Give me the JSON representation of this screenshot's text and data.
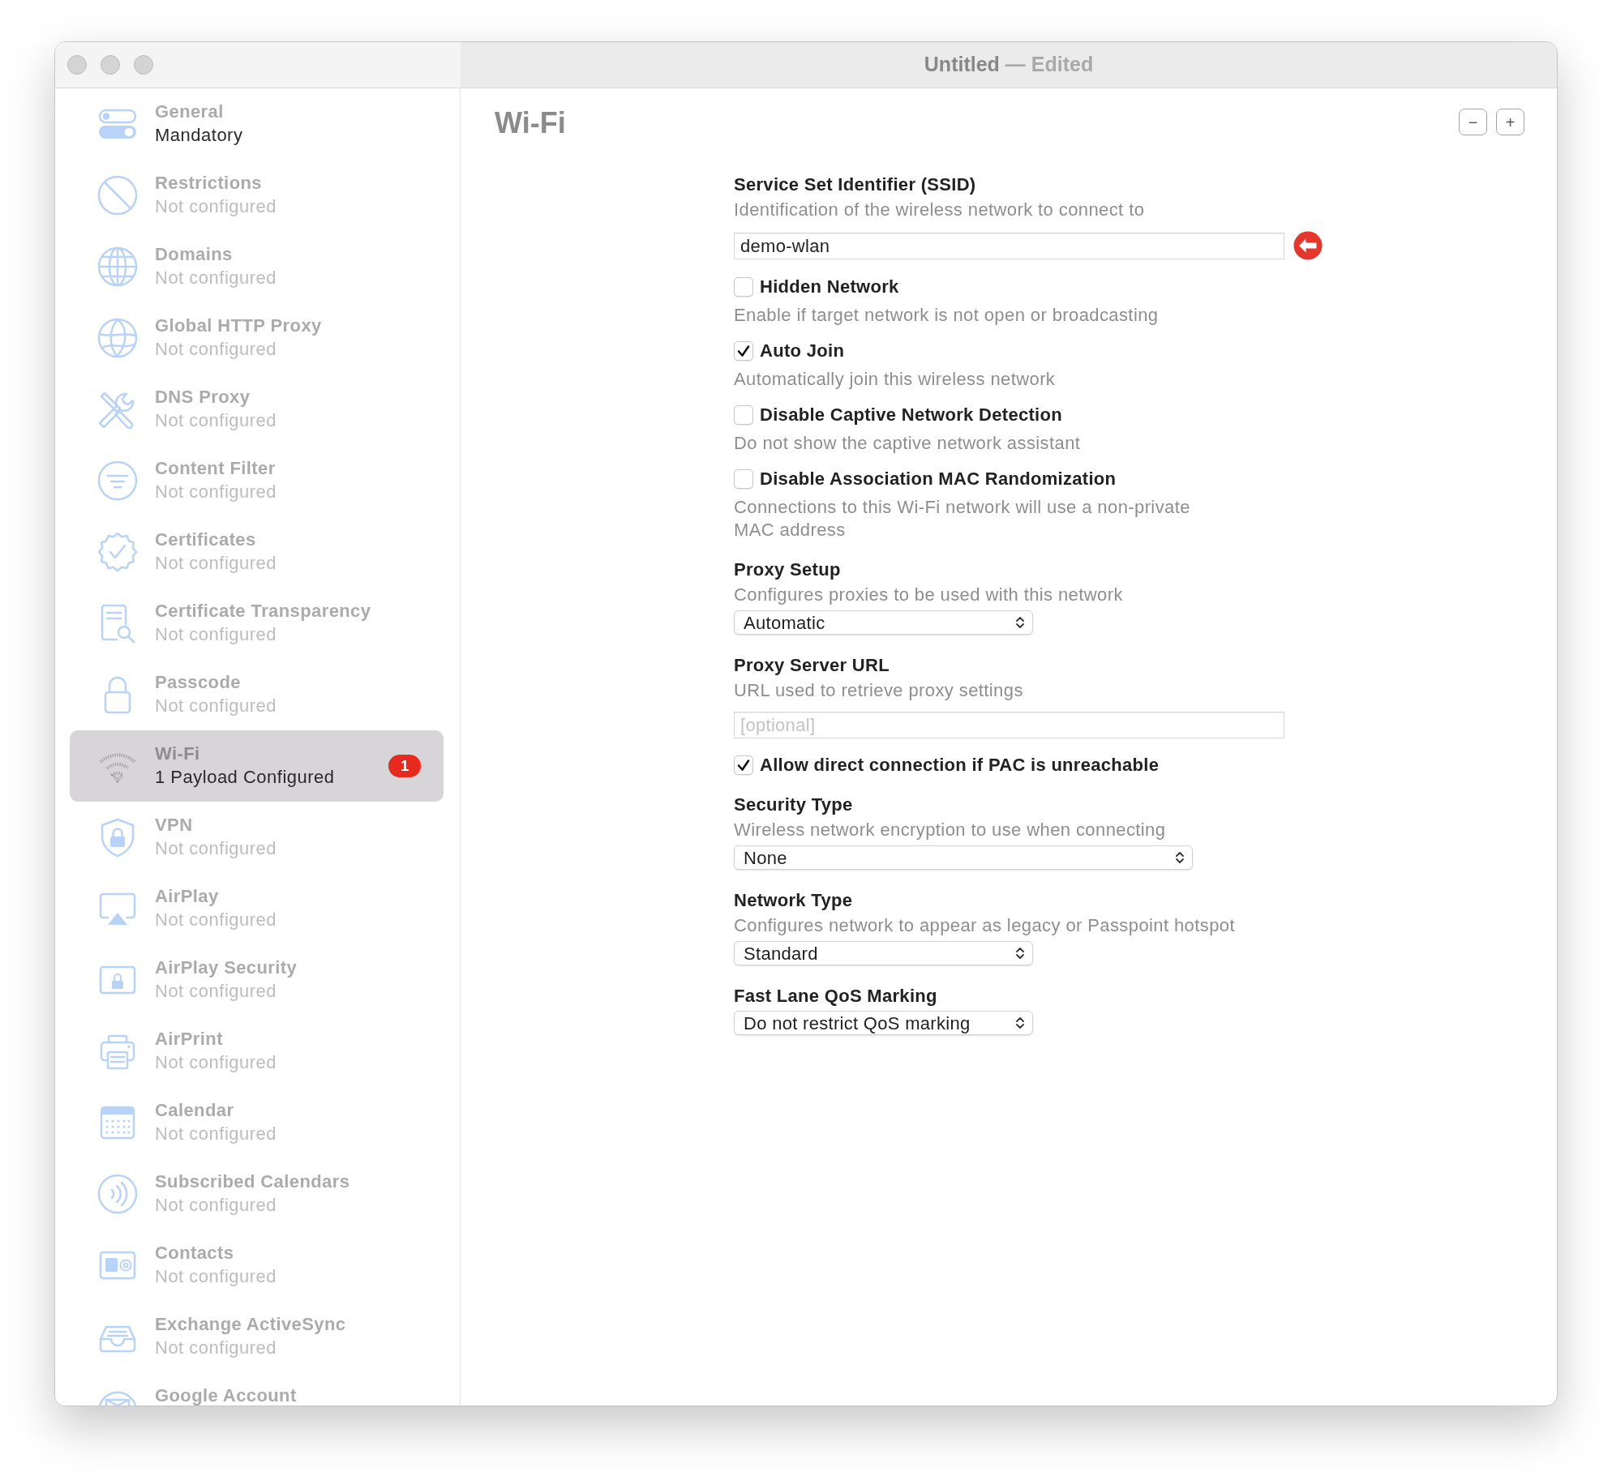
{
  "window": {
    "title": "Untitled",
    "separator": "—",
    "status": "Edited"
  },
  "sidebar": {
    "items": [
      {
        "kind": "general",
        "title": "General",
        "subtitle": "Mandatory",
        "configured": true,
        "selected": false
      },
      {
        "kind": "restrictions",
        "title": "Restrictions",
        "subtitle": "Not configured",
        "configured": false,
        "selected": false
      },
      {
        "kind": "domains",
        "title": "Domains",
        "subtitle": "Not configured",
        "configured": false,
        "selected": false
      },
      {
        "kind": "proxy",
        "title": "Global HTTP Proxy",
        "subtitle": "Not configured",
        "configured": false,
        "selected": false
      },
      {
        "kind": "dns",
        "title": "DNS Proxy",
        "subtitle": "Not configured",
        "configured": false,
        "selected": false
      },
      {
        "kind": "filter",
        "title": "Content Filter",
        "subtitle": "Not configured",
        "configured": false,
        "selected": false
      },
      {
        "kind": "certificates",
        "title": "Certificates",
        "subtitle": "Not configured",
        "configured": false,
        "selected": false
      },
      {
        "kind": "transparency",
        "title": "Certificate Transparency",
        "subtitle": "Not configured",
        "configured": false,
        "selected": false
      },
      {
        "kind": "passcode",
        "title": "Passcode",
        "subtitle": "Not configured",
        "configured": false,
        "selected": false
      },
      {
        "kind": "wifi",
        "title": "Wi-Fi",
        "subtitle": "1 Payload Configured",
        "configured": true,
        "selected": true,
        "badge": "1"
      },
      {
        "kind": "vpn",
        "title": "VPN",
        "subtitle": "Not configured",
        "configured": false,
        "selected": false
      },
      {
        "kind": "airplay",
        "title": "AirPlay",
        "subtitle": "Not configured",
        "configured": false,
        "selected": false
      },
      {
        "kind": "airplaysecurity",
        "title": "AirPlay Security",
        "subtitle": "Not configured",
        "configured": false,
        "selected": false
      },
      {
        "kind": "airprint",
        "title": "AirPrint",
        "subtitle": "Not configured",
        "configured": false,
        "selected": false
      },
      {
        "kind": "calendar",
        "title": "Calendar",
        "subtitle": "Not configured",
        "configured": false,
        "selected": false
      },
      {
        "kind": "subscriptions",
        "title": "Subscribed Calendars",
        "subtitle": "Not configured",
        "configured": false,
        "selected": false
      },
      {
        "kind": "contacts",
        "title": "Contacts",
        "subtitle": "Not configured",
        "configured": false,
        "selected": false
      },
      {
        "kind": "exchange",
        "title": "Exchange ActiveSync",
        "subtitle": "Not configured",
        "configured": false,
        "selected": false
      },
      {
        "kind": "google",
        "title": "Google Account",
        "selected": false
      }
    ]
  },
  "content": {
    "title": "Wi-Fi",
    "buttons": [
      "−",
      "+"
    ],
    "fields": [
      {
        "kind": "text",
        "label": "Service Set Identifier (SSID)",
        "description": "Identification of the wireless network to connect to",
        "value": "demo-wlan",
        "warning": true
      },
      {
        "kind": "checkbox",
        "label": "Hidden Network",
        "description": "Enable if target network is not open or broadcasting",
        "checked": false
      },
      {
        "kind": "checkbox",
        "label": "Auto Join",
        "description": "Automatically join this wireless network",
        "checked": true
      },
      {
        "kind": "checkbox",
        "label": "Disable Captive Network Detection",
        "description": "Do not show the captive network assistant",
        "checked": false
      },
      {
        "kind": "checkbox",
        "label": "Disable Association MAC Randomization",
        "description": "Connections to this Wi-Fi network will use a non-private MAC address",
        "checked": false
      },
      {
        "kind": "popup",
        "label": "Proxy Setup",
        "description": "Configures proxies to be used with this network",
        "value": "Automatic",
        "wide": false
      },
      {
        "kind": "text",
        "label": "Proxy Server URL",
        "description": "URL used to retrieve proxy settings",
        "placeholder": "[optional]"
      },
      {
        "kind": "checkbox",
        "label": "Allow direct connection if PAC is unreachable",
        "checked": true
      },
      {
        "kind": "popup",
        "label": "Security Type",
        "description": "Wireless network encryption to use when connecting",
        "value": "None",
        "wide": true
      },
      {
        "kind": "popup",
        "label": "Network Type",
        "description": "Configures network to appear as legacy or Passpoint hotspot",
        "value": "Standard",
        "wide": false
      },
      {
        "kind": "popup",
        "label": "Fast Lane QoS Marking",
        "value": "Do not restrict QoS marking",
        "wide": false
      }
    ]
  }
}
